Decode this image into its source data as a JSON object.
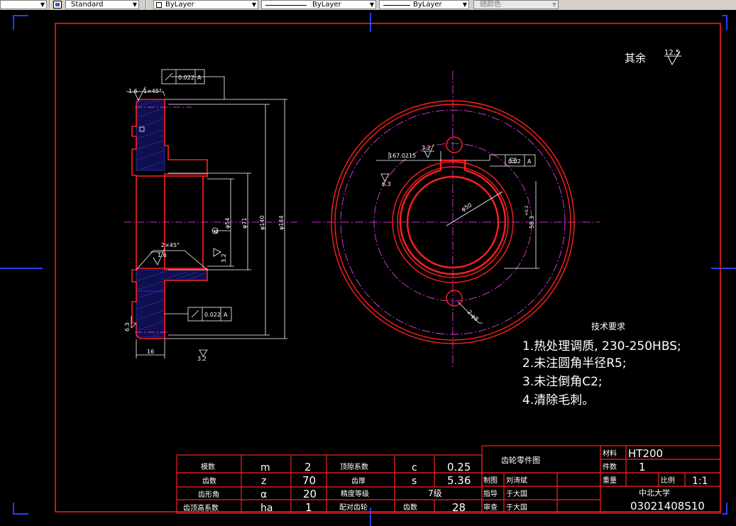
{
  "toolbar": {
    "textstyle": "Standard",
    "layer": "ByLayer",
    "linetype": "ByLayer",
    "lineweight": "ByLayer",
    "color": "随颜色"
  },
  "drawing": {
    "roughness_note": "其余",
    "roughness_value": "12.5",
    "section": {
      "r16": "1.6",
      "chamfer1": "1×45°",
      "tol_value": "0.022",
      "datum": "A",
      "chamfer2": "2×45°",
      "r16b": "1.6",
      "dim54": "φ54",
      "dim71": "φ71",
      "dim140": "φ140",
      "dim144": "φ144",
      "r32a": "3.2",
      "r63": "6.3",
      "dim16": "16",
      "r32b": "3.2",
      "datum_marker": "A",
      "tol2_value": "0.022",
      "datum2": "A"
    },
    "front": {
      "r32": "3.2",
      "dim167": "167.0215",
      "tol_value": "0.02",
      "datum": "A",
      "r63": "6.3",
      "dim50": "φ50",
      "dim583": "58.3",
      "dim583_sup": "+0.2",
      "dim8": "2-φ8"
    },
    "tech": {
      "title": "技术要求",
      "line1": "1.热处理调质, 230-250HBS;",
      "line2": "2.未注圆角半径R5;",
      "line3": "3.未注倒角C2;",
      "line4": "4.清除毛刺。"
    },
    "params": {
      "rows": [
        {
          "name": "模数",
          "sym": "m",
          "val": "2",
          "name2": "顶隙系数",
          "sym2": "c",
          "val2": "0.25"
        },
        {
          "name": "齿数",
          "sym": "z",
          "val": "70",
          "name2": "齿厚",
          "sym2": "s",
          "val2": "5.36"
        },
        {
          "name": "齿形角",
          "sym": "α",
          "val": "20",
          "name2": "精度等级",
          "sym2": "",
          "val2": "7级"
        },
        {
          "name": "齿顶高系数",
          "sym": "ha",
          "val": "1",
          "name2": "配对齿轮",
          "sym2": "齿数",
          "val2": "28"
        }
      ]
    },
    "title_block": {
      "name": "齿轮零件图",
      "material_label": "材料",
      "material": "HT200",
      "qty_label": "件数",
      "qty": "1",
      "weight_label": "重量",
      "scale_label": "比例",
      "scale": "1:1",
      "drawn_label": "制图",
      "drawn": "刘涛斌",
      "guide_label": "指导",
      "guide": "于大国",
      "check_label": "审查",
      "check": "于大国",
      "school": "中北大学",
      "number": "03021408S10"
    }
  }
}
